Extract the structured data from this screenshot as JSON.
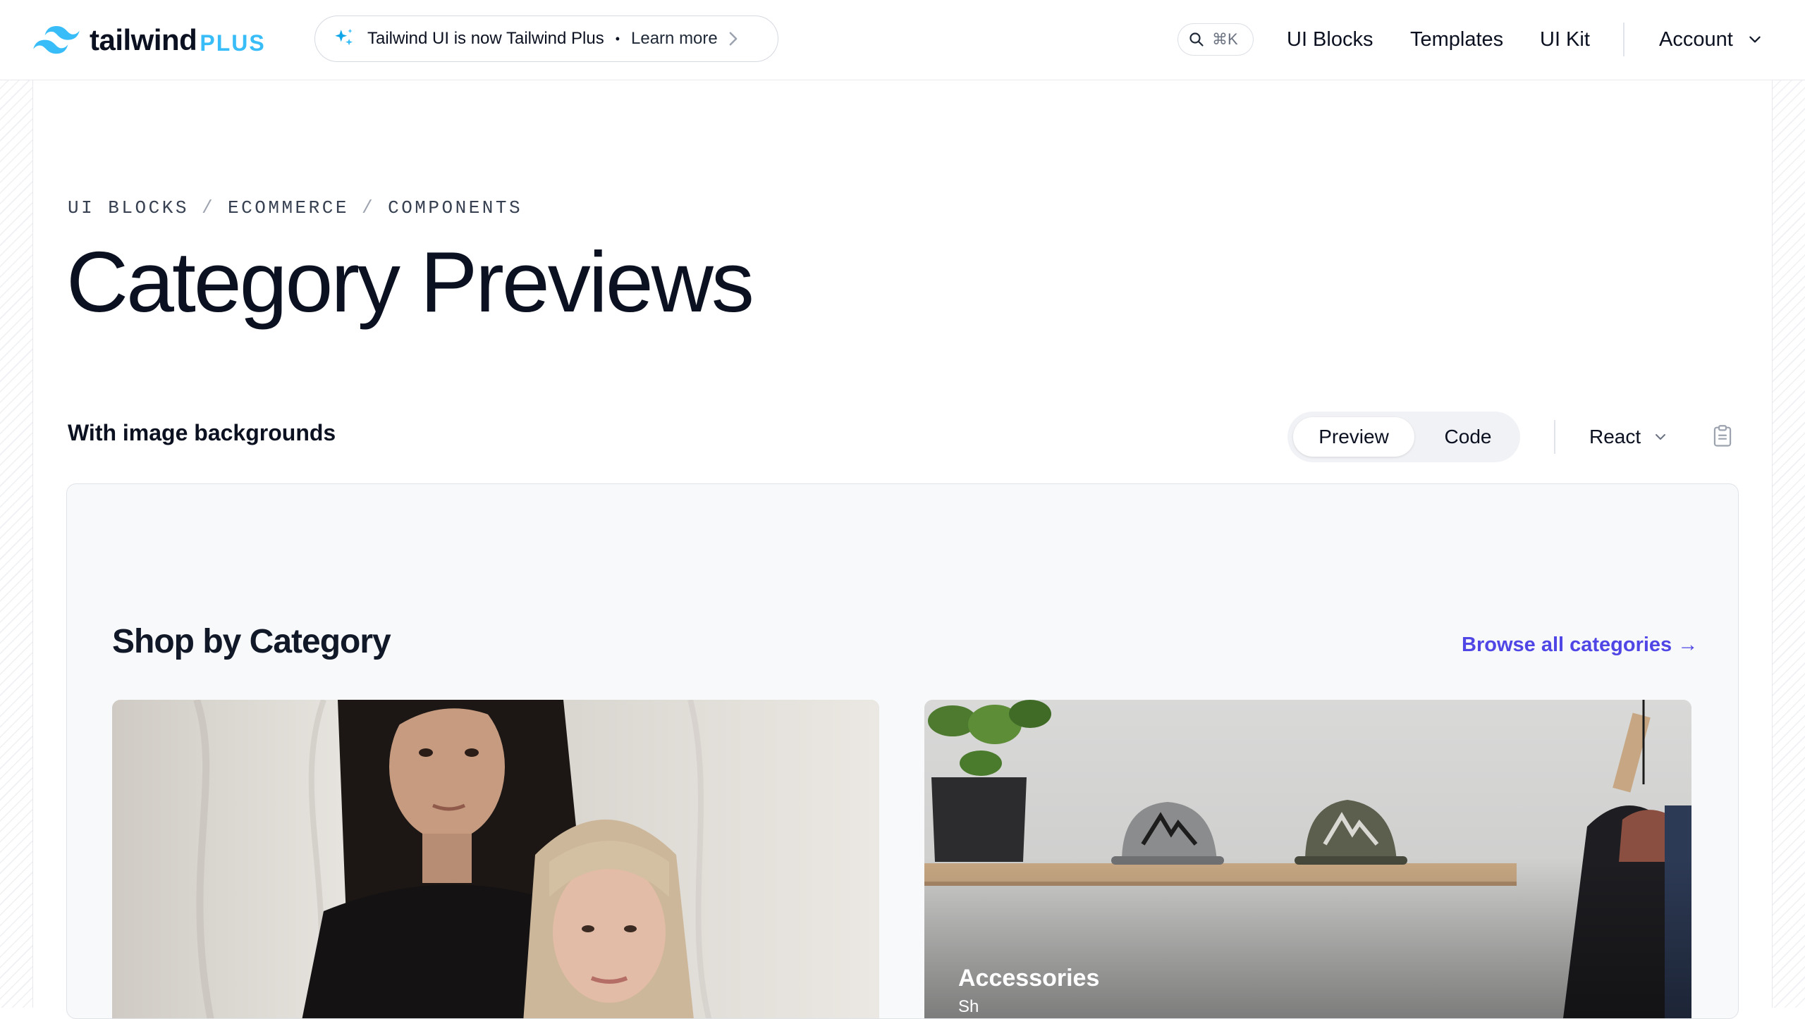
{
  "header": {
    "logo_text": "tailwind",
    "logo_suffix": "PLUS",
    "announcement": "Tailwind UI is now Tailwind Plus",
    "announcement_separator": "•",
    "announcement_link": "Learn more",
    "search_shortcut": "⌘K",
    "nav": [
      "UI Blocks",
      "Templates",
      "UI Kit"
    ],
    "account_label": "Account",
    "icons": [
      "tailwind-logo-icon",
      "sparkle-icon",
      "chevron-right-icon",
      "search-icon",
      "chevron-down-icon"
    ]
  },
  "breadcrumb": [
    "UI BLOCKS",
    "ECOMMERCE",
    "COMPONENTS"
  ],
  "breadcrumb_separator": "/",
  "page_title": "Category Previews",
  "example": {
    "title": "With image backgrounds",
    "tabs": [
      "Preview",
      "Code"
    ],
    "active_tab": "Preview",
    "framework": "React",
    "copy_icon": "clipboard-icon"
  },
  "preview": {
    "heading": "Shop by Category",
    "browse_link": "Browse all categories →",
    "cards": [
      {
        "label": "",
        "sub": ""
      },
      {
        "label": "Accessories",
        "sub": "Sh"
      }
    ]
  },
  "colors": {
    "accent": "#38bdf8",
    "link": "#4f46e5",
    "text": "#0b1120",
    "panel_bg": "#f8f9fb"
  }
}
